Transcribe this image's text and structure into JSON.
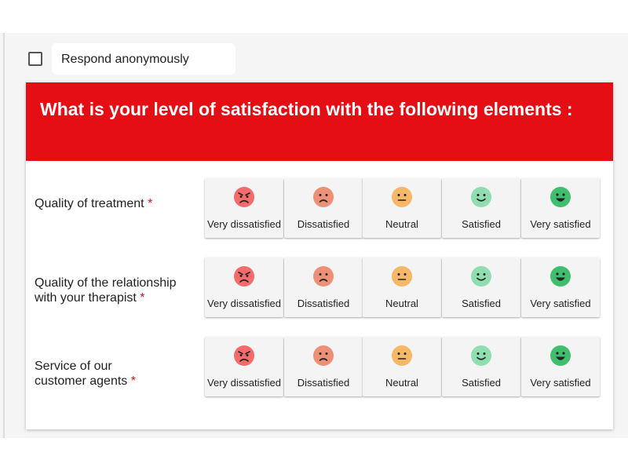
{
  "anonymous": {
    "label": "Respond anonymously",
    "checked": false
  },
  "card": {
    "title": "What is your level of satisfaction with the following elements :"
  },
  "colors": {
    "header": "#e50e14",
    "required": "#e50e14",
    "very_dissatisfied": "#f36c6c",
    "dissatisfied": "#ec9077",
    "neutral": "#f5b869",
    "satisfied": "#90deb0",
    "very_satisfied": "#3fbf6e"
  },
  "options": [
    {
      "label": "Very dissatisfied",
      "icon": "angry-face-icon"
    },
    {
      "label": "Dissatisfied",
      "icon": "frown-face-icon"
    },
    {
      "label": "Neutral",
      "icon": "neutral-face-icon"
    },
    {
      "label": "Satisfied",
      "icon": "smile-face-icon"
    },
    {
      "label": "Very satisfied",
      "icon": "grin-face-icon"
    }
  ],
  "questions": [
    {
      "line1": "Quality of treatment",
      "line2": "",
      "required_mark": "*"
    },
    {
      "line1": "Quality of the relationship",
      "line2": "with your therapist",
      "required_mark": "*"
    },
    {
      "line1": "Service of our",
      "line2": "customer agents",
      "required_mark": "*"
    }
  ]
}
